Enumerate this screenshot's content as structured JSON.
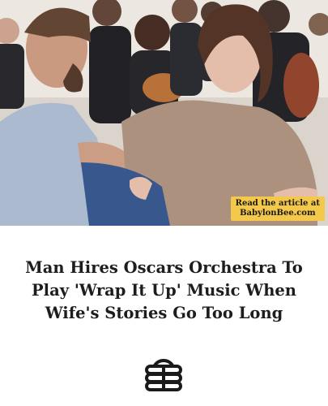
{
  "photo": {
    "badge_line1": "Read the article at",
    "badge_line2": "BabylonBee.com"
  },
  "headline": "Man Hires Oscars Orchestra To Play 'Wrap It Up' Music When Wife's Stories Go Too Long",
  "logo": {
    "icon": "babylon-bee-logo-icon"
  },
  "colors": {
    "badge": "#f3c84b",
    "headline": "#1d1d1d",
    "logo": "#1a1a1a"
  }
}
